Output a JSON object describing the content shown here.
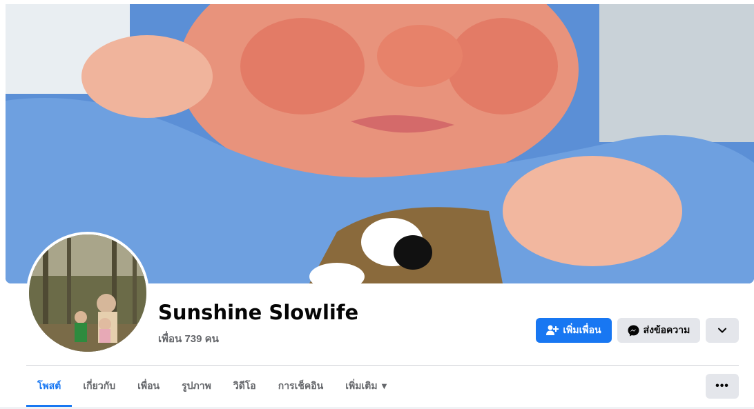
{
  "profile": {
    "name": "Sunshine Slowlife",
    "friends": "เพื่อน 739 คน"
  },
  "actions": {
    "add_friend_label": "เพิ่มเพื่อน",
    "message_label": "ส่งข้อความ"
  },
  "tabs": [
    {
      "label": "โพสต์",
      "active": true
    },
    {
      "label": "เกี่ยวกับ"
    },
    {
      "label": "เพื่อน"
    },
    {
      "label": "รูปภาพ"
    },
    {
      "label": "วิดีโอ"
    },
    {
      "label": "การเช็คอิน"
    },
    {
      "label": "เพิ่มเติม",
      "has_dropdown": true
    }
  ],
  "icons": {
    "add_friend": "person-add-icon",
    "messenger": "messenger-icon",
    "more_actions": "chevron-down-icon",
    "tabs_more": "ellipsis-icon"
  },
  "colors": {
    "accent": "#1877f2",
    "secondary_button": "#e4e6eb",
    "muted_text": "#65676b"
  }
}
